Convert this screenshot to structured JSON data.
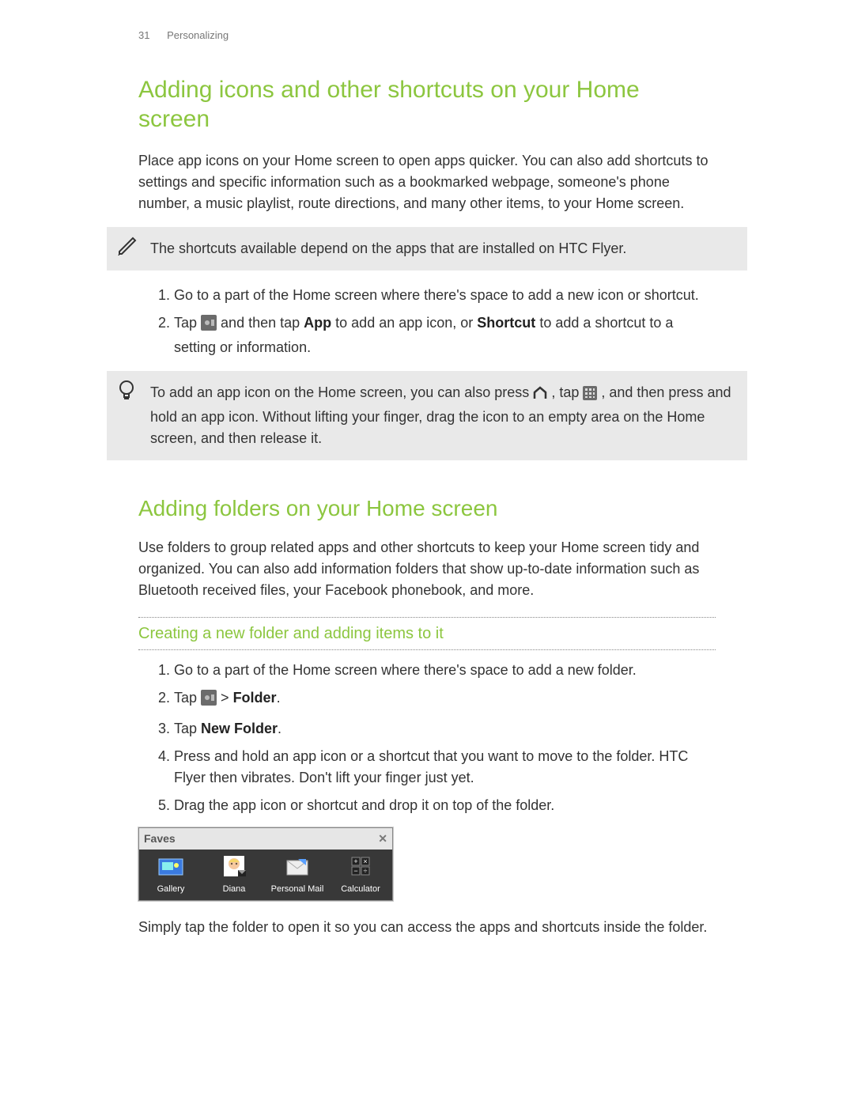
{
  "header": {
    "page_number": "31",
    "section": "Personalizing"
  },
  "section1": {
    "title": "Adding icons and other shortcuts on your Home screen",
    "intro": "Place app icons on your Home screen to open apps quicker. You can also add shortcuts to settings and specific information such as a bookmarked webpage, someone's phone number, a music playlist, route directions, and many other items, to your Home screen.",
    "note1": "The shortcuts available depend on the apps that are installed on HTC Flyer.",
    "step1": "Go to a part of the Home screen where there's space to add a new icon or shortcut.",
    "step2_pre": "Tap ",
    "step2_mid1": " and then tap ",
    "step2_app": "App",
    "step2_mid2": " to add an app icon, or ",
    "step2_shortcut": "Shortcut",
    "step2_post": " to add a shortcut to a setting or information.",
    "tip_pre": "To add an app icon on the Home screen, you can also press ",
    "tip_mid": " , tap ",
    "tip_post": ", and then press and hold an app icon. Without lifting your finger, drag the icon to an empty area on the Home screen, and then release it."
  },
  "section2": {
    "title": "Adding folders on your Home screen",
    "intro": "Use folders to group related apps and other shortcuts to keep your Home screen tidy and organized. You can also add information folders that show up-to-date information such as Bluetooth received files, your Facebook phonebook, and more.",
    "sub_title": "Creating a new folder and adding items to it",
    "step1": "Go to a part of the Home screen where there's space to add a new folder.",
    "step2_pre": "Tap ",
    "step2_sep": " > ",
    "step2_folder": "Folder",
    "step2_post": ".",
    "step3_pre": "Tap ",
    "step3_newfolder": "New Folder",
    "step3_post": ".",
    "step4": "Press and hold an app icon or a shortcut that you want to move to the folder. HTC Flyer then vibrates. Don't lift your finger just yet.",
    "step5": "Drag the app icon or shortcut and drop it on top of the folder.",
    "after": "Simply tap the folder to open it so you can access the apps and shortcuts inside the folder."
  },
  "folder_widget": {
    "title": "Faves",
    "items": [
      {
        "label": "Gallery"
      },
      {
        "label": "Diana"
      },
      {
        "label": "Personal Mail"
      },
      {
        "label": "Calculator"
      }
    ]
  }
}
